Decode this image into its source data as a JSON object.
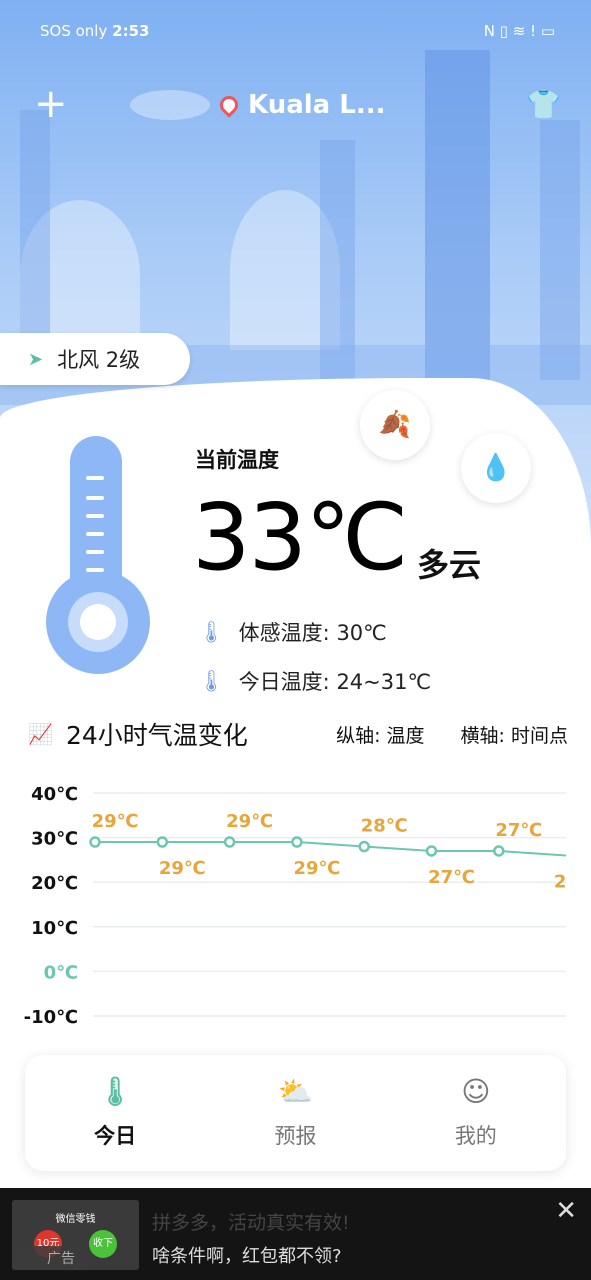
{
  "status_bar": {
    "carrier": "SOS only",
    "time": "2:53",
    "icons": [
      "nfc-icon",
      "vibrate-icon",
      "wifi-icon",
      "alert-icon",
      "battery-icon"
    ]
  },
  "header": {
    "add_icon": "plus-icon",
    "city": "Kuala L...",
    "location_icon": "location-pin-icon",
    "theme_icon": "tshirt-icon"
  },
  "wind": {
    "text": "北风 2级",
    "icon": "navigation-arrow-icon"
  },
  "current": {
    "label": "当前温度",
    "temperature": "33℃",
    "condition": "多云",
    "feels_like_label": "体感温度:",
    "feels_like": "30℃",
    "today_label": "今日温度:",
    "today_range": "24~31℃"
  },
  "chart_header": {
    "title": "24小时气温变化",
    "y_axis_note": "纵轴: 温度",
    "x_axis_note": "横轴: 时间点"
  },
  "chart_data": {
    "type": "line",
    "y_ticks": [
      "40℃",
      "30℃",
      "20℃",
      "10℃",
      "0℃",
      "-10℃"
    ],
    "y_tick_values": [
      40,
      30,
      20,
      10,
      0,
      -10
    ],
    "ylim": [
      -10,
      40
    ],
    "grid": true,
    "series": [
      {
        "values": [
          29,
          29,
          29,
          29,
          28,
          27,
          27,
          26
        ],
        "labels": [
          "29℃",
          "29℃",
          "29℃",
          "29℃",
          "28℃",
          "27℃",
          "27℃",
          "2"
        ]
      }
    ],
    "colors": {
      "line": "#6cc7b0",
      "label": "#e8a63a",
      "zero_tick": "#6cc7b0"
    }
  },
  "nav": {
    "items": [
      {
        "label": "今日",
        "icon": "thermometer-icon",
        "active": true
      },
      {
        "label": "预报",
        "icon": "cloud-sun-icon"
      },
      {
        "label": "我的",
        "icon": "user-icon"
      }
    ]
  },
  "ad": {
    "image_title": "微信零钱",
    "image_amount": "10元",
    "image_button": "收下",
    "badge": "广告",
    "line1": "拼多多，活动真实有效!",
    "line2": "啥条件啊，红包都不领?",
    "close_icon": "close-icon"
  }
}
